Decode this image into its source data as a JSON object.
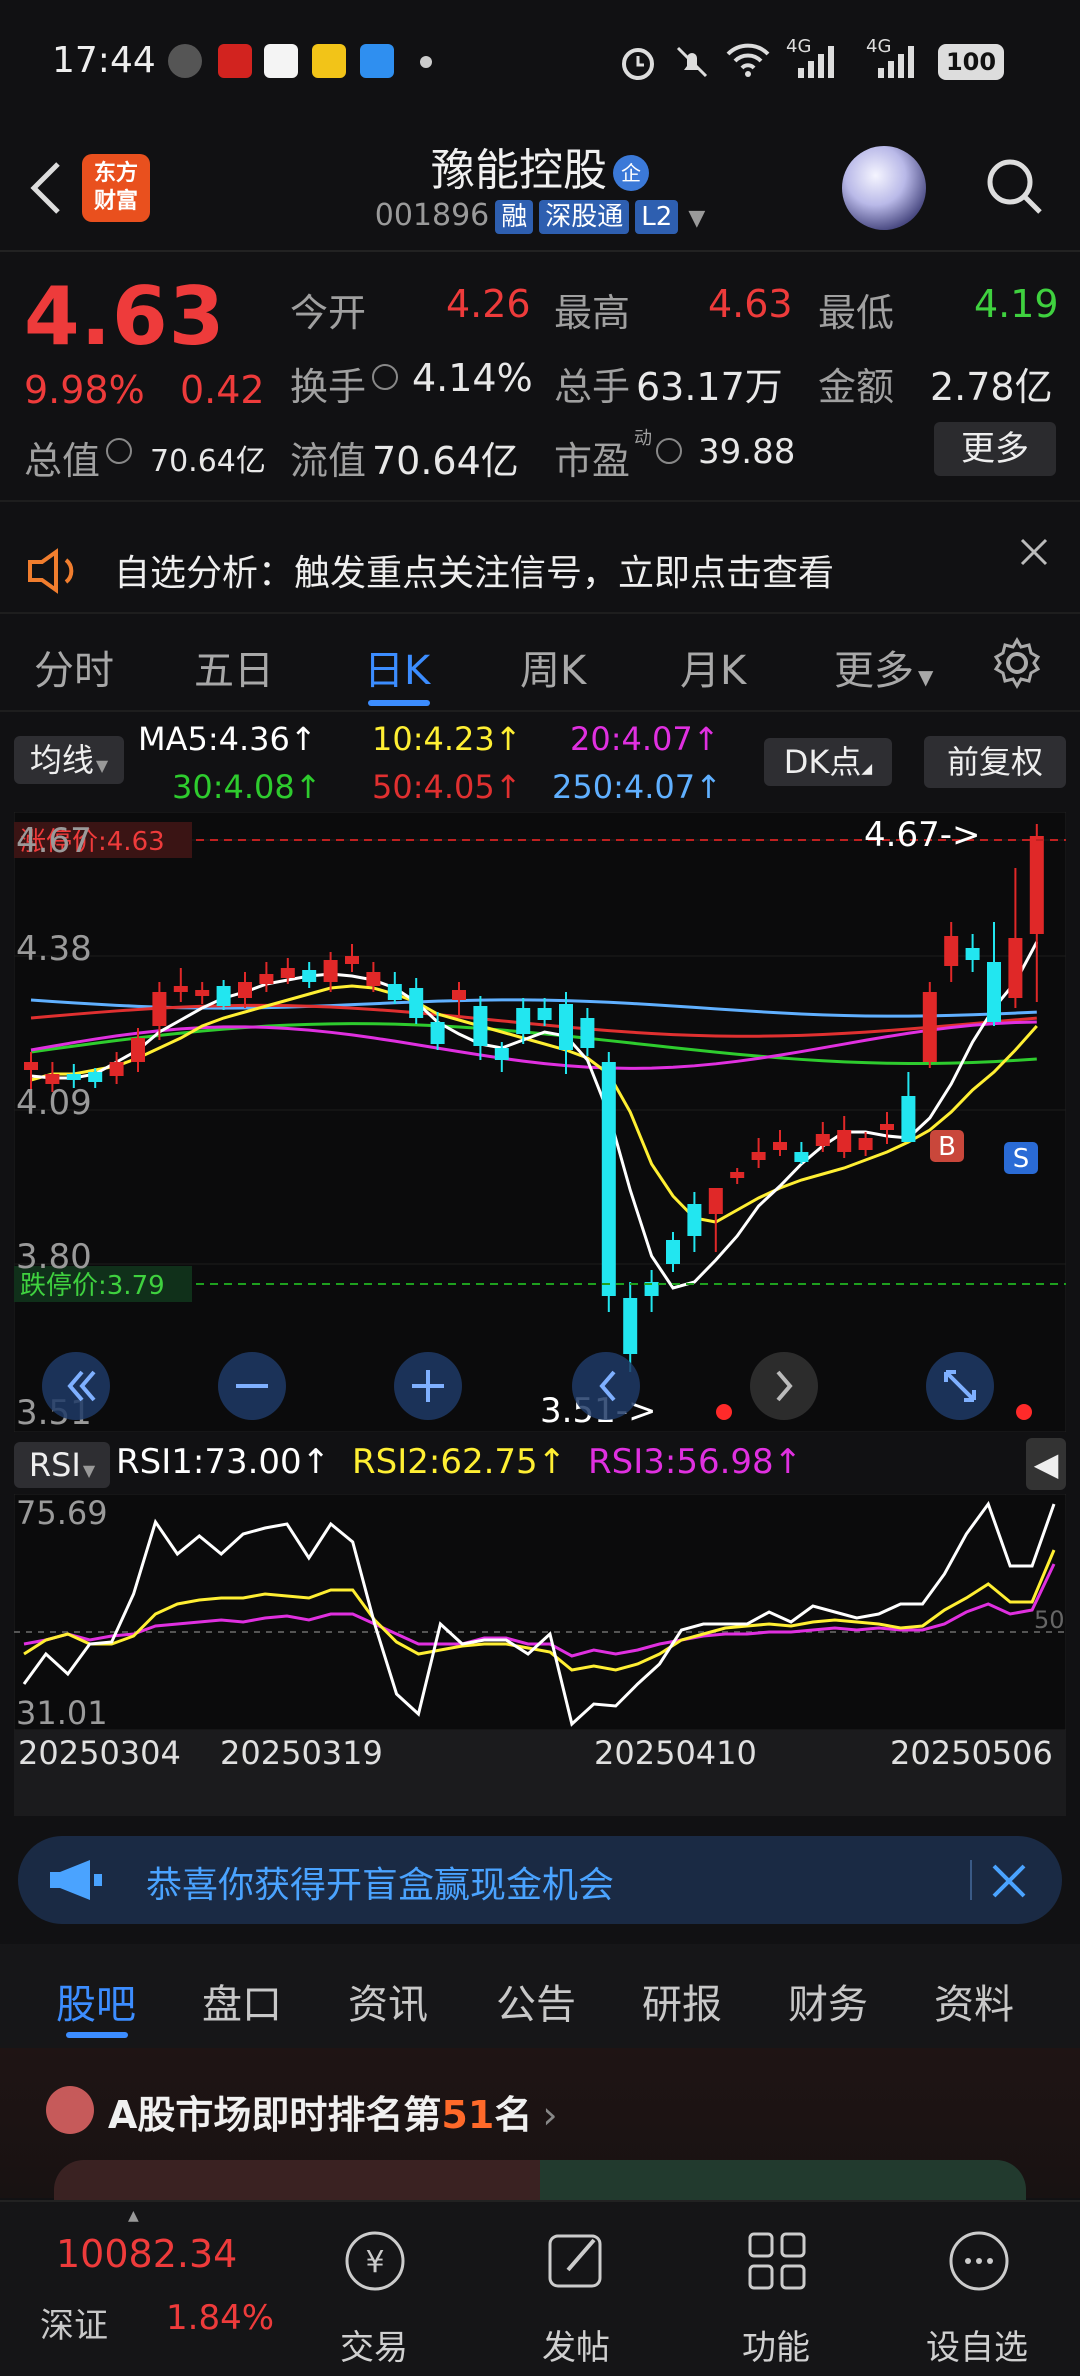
{
  "status": {
    "time": "17:44",
    "battery": "100",
    "net1": "4G",
    "net2": "4G"
  },
  "header": {
    "logo_line1": "东方",
    "logo_line2": "财富",
    "name": "豫能控股",
    "name_badge": "企",
    "code": "001896",
    "tags": [
      "融",
      "深股通",
      "L2"
    ]
  },
  "quote": {
    "price": "4.63",
    "change_pct": "9.98%",
    "change": "0.42",
    "open_label": "今开",
    "open": "4.26",
    "high_label": "最高",
    "high": "4.63",
    "low_label": "最低",
    "low": "4.19",
    "turnover_label": "换手",
    "turnover": "4.14%",
    "volume_label": "总手",
    "volume": "63.17万",
    "amount_label": "金额",
    "amount": "2.78亿",
    "mcap_label": "总值",
    "mcap": "70.64亿",
    "float_label": "流值",
    "float": "70.64亿",
    "pe_label": "市盈",
    "pe_sup": "动",
    "pe": "39.88",
    "more": "更多"
  },
  "notice": {
    "text": "自选分析：触发重点关注信号，立即点击查看"
  },
  "ktabs": {
    "items": [
      "分时",
      "五日",
      "日K",
      "周K",
      "月K",
      "更多"
    ],
    "active": "日K"
  },
  "ma": {
    "toggle": "均线",
    "ma5": "MA5:4.36↑",
    "ma10": "10:4.23↑",
    "ma20": "20:4.07↑",
    "ma30": "30:4.08↑",
    "ma50": "50:4.05↑",
    "ma250": "250:4.07↑",
    "dk": "DK点",
    "fq": "前复权",
    "colors": {
      "ma5": "#ffffff",
      "ma10": "#ffef33",
      "ma20": "#e030e0",
      "ma30": "#2ecc2e",
      "ma50": "#e03030",
      "ma250": "#60b0ff"
    }
  },
  "kline": {
    "yticks": [
      "4.67",
      "4.38",
      "4.09",
      "3.80",
      "3.51"
    ],
    "limit_up": "涨停价:4.63",
    "limit_down": "跌停价:3.79",
    "max_label": "4.67->",
    "min_label": "3.51->",
    "buy_marker": "B",
    "sell_marker": "S",
    "up_color": "#e02828",
    "down_color": "#22e6f0"
  },
  "rsi": {
    "toggle": "RSI",
    "rsi1": "RSI1:73.00↑",
    "rsi2": "RSI2:62.75↑",
    "rsi3": "RSI3:56.98↑",
    "ytop": "75.69",
    "ybottom": "31.01",
    "mid": "50"
  },
  "dates": [
    "20250304",
    "20250319",
    "20250410",
    "20250506"
  ],
  "banner": {
    "text": "恭喜你获得开盲盒赢现金机会"
  },
  "btabs": {
    "items": [
      "股吧",
      "盘口",
      "资讯",
      "公告",
      "研报",
      "财务",
      "资料"
    ],
    "active": "股吧"
  },
  "rank": {
    "prefix": "A股市场即时排名第",
    "num": "51",
    "suffix": "名"
  },
  "bnav": {
    "index_value": "10082.34",
    "index_name": "深证",
    "index_change": "1.84%",
    "items": [
      "交易",
      "发帖",
      "功能",
      "设自选"
    ]
  }
}
